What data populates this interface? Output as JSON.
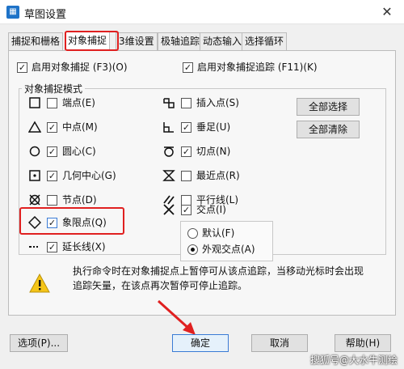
{
  "window": {
    "title": "草图设置",
    "icon": "app-icon",
    "close_label": "✕"
  },
  "tabs": [
    {
      "label": "捕捉和栅格",
      "active": false
    },
    {
      "label": "对象捕捉",
      "active": true
    },
    {
      "label": "3维设置",
      "active": false
    },
    {
      "label": "极轴追踪",
      "active": false
    },
    {
      "label": "动态输入",
      "active": false
    },
    {
      "label": "选择循环",
      "active": false
    }
  ],
  "top_options": {
    "snap_on": {
      "label": "启用对象捕捉 (F3)(O)",
      "checked": true
    },
    "track_on": {
      "label": "启用对象捕捉追踪 (F11)(K)",
      "checked": true
    }
  },
  "group": {
    "label": "对象捕捉模式"
  },
  "left_modes": [
    {
      "label": "端点(E)",
      "checked": false,
      "icon": "endpoint-square-icon"
    },
    {
      "label": "中点(M)",
      "checked": true,
      "icon": "midpoint-triangle-icon"
    },
    {
      "label": "圆心(C)",
      "checked": true,
      "icon": "center-circle-icon"
    },
    {
      "label": "几何中心(G)",
      "checked": true,
      "icon": "geometric-center-icon"
    },
    {
      "label": "节点(D)",
      "checked": false,
      "icon": "node-icon"
    },
    {
      "label": "象限点(Q)",
      "checked": true,
      "icon": "quadrant-diamond-icon"
    },
    {
      "label": "延长线(X)",
      "checked": true,
      "icon": "extension-icon"
    }
  ],
  "right_modes": [
    {
      "label": "插入点(S)",
      "checked": false,
      "icon": "insertion-icon"
    },
    {
      "label": "垂足(U)",
      "checked": true,
      "icon": "perpendicular-icon"
    },
    {
      "label": "切点(N)",
      "checked": true,
      "icon": "tangent-icon"
    },
    {
      "label": "最近点(R)",
      "checked": false,
      "icon": "nearest-icon"
    },
    {
      "label": "平行线(L)",
      "checked": false,
      "icon": "parallel-icon"
    },
    {
      "label": "交点(I)",
      "checked": true,
      "icon": "intersection-icon"
    }
  ],
  "intersection_radio": [
    {
      "label": "默认(F)",
      "selected": false
    },
    {
      "label": "外观交点(A)",
      "selected": true
    }
  ],
  "side_buttons": {
    "select_all": "全部选择",
    "clear_all": "全部清除"
  },
  "info": {
    "text": "执行命令时在对象捕捉点上暂停可从该点追踪，当移动光标时会出现追踪矢量，在该点再次暂停可停止追踪。",
    "icon": "warning-icon"
  },
  "bottom_buttons": {
    "options": "选项(P)...",
    "ok": "确定",
    "cancel": "取消",
    "help": "帮助(H)"
  },
  "watermark": "搜狐号@大水牛测绘",
  "colors": {
    "highlight_red": "#e02020",
    "accent_blue": "#1e73c8"
  }
}
